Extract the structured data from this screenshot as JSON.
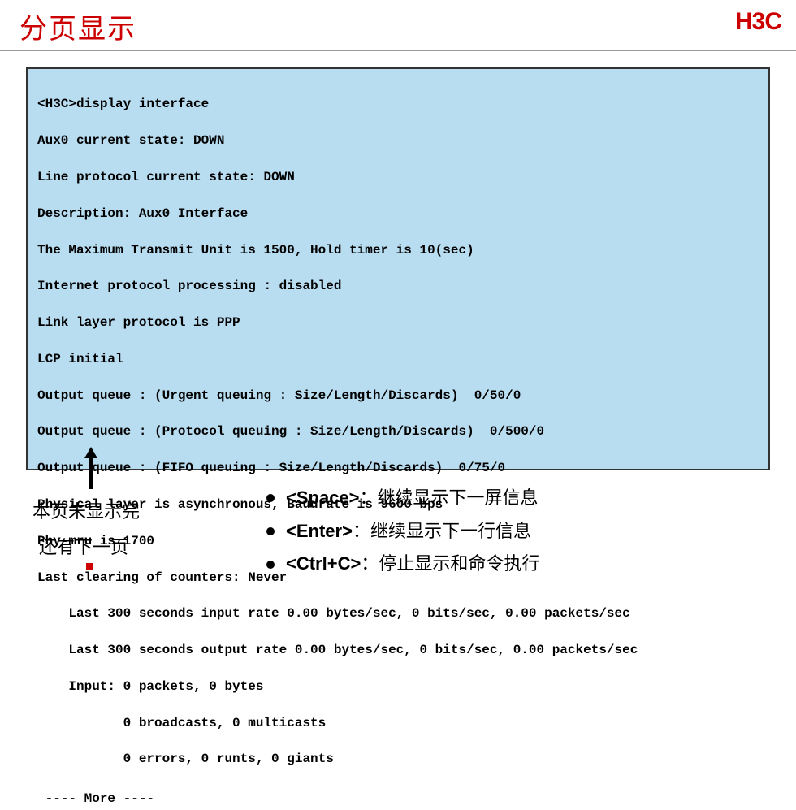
{
  "header": {
    "title": "分页显示",
    "logo": "H3C"
  },
  "terminal": {
    "l0": "<H3C>display interface",
    "l1": "Aux0 current state: DOWN",
    "l2": "Line protocol current state: DOWN",
    "l3": "Description: Aux0 Interface",
    "l4": "The Maximum Transmit Unit is 1500, Hold timer is 10(sec)",
    "l5": "Internet protocol processing : disabled",
    "l6": "Link layer protocol is PPP",
    "l7": "LCP initial",
    "l8": "Output queue : (Urgent queuing : Size/Length/Discards)  0/50/0",
    "l9": "Output queue : (Protocol queuing : Size/Length/Discards)  0/500/0",
    "l10": "Output queue : (FIFO queuing : Size/Length/Discards)  0/75/0",
    "l11": "Physical layer is asynchronous, Baudrate is 9600 bps",
    "l12": "Phy-mru is 1700",
    "l13": "Last clearing of counters: Never",
    "l14": "    Last 300 seconds input rate 0.00 bytes/sec, 0 bits/sec, 0.00 packets/sec",
    "l15": "    Last 300 seconds output rate 0.00 bytes/sec, 0 bits/sec, 0.00 packets/sec",
    "l16": "    Input: 0 packets, 0 bytes",
    "l17": "           0 broadcasts, 0 multicasts",
    "l18": "           0 errors, 0 runts, 0 giants",
    "more": " ---- More ----"
  },
  "annotation_left": {
    "line1": "本页未显示完",
    "line2": "还有下一页"
  },
  "bullets": {
    "b0_key": "<Space>",
    "b0_desc": "：继续显示下一屏信息",
    "b1_key": "<Enter>",
    "b1_desc": "：继续显示下一行信息",
    "b2_key": "<Ctrl+C>",
    "b2_desc": "：停止显示和命令执行"
  }
}
